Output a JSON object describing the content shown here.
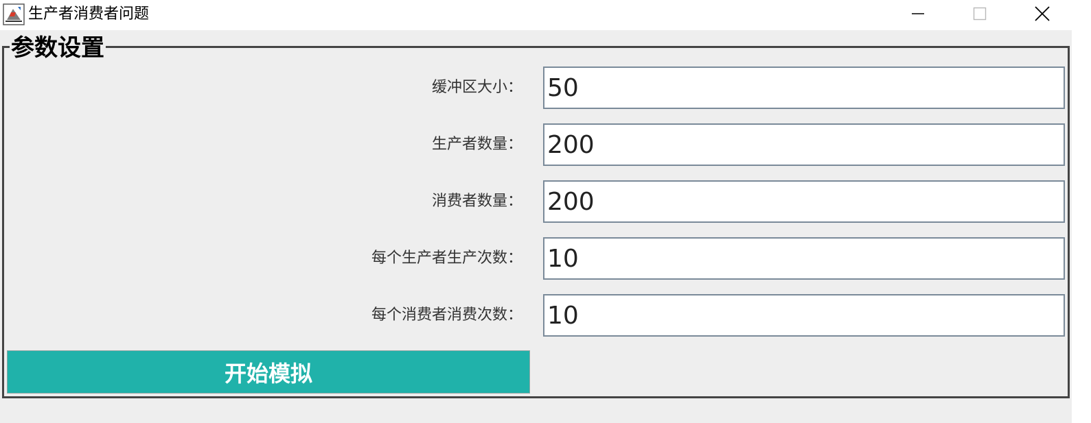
{
  "window": {
    "title": "生产者消费者问题",
    "icon": "java-app-icon",
    "controls": [
      "minimize-icon",
      "maximize-icon",
      "close-icon"
    ]
  },
  "group": {
    "title": "参数设置"
  },
  "fields": [
    {
      "label": "缓冲区大小：",
      "value": "50"
    },
    {
      "label": "生产者数量：",
      "value": "200"
    },
    {
      "label": "消费者数量：",
      "value": "200"
    },
    {
      "label": "每个生产者生产次数：",
      "value": "10"
    },
    {
      "label": "每个消费者消费次数：",
      "value": "10"
    }
  ],
  "actions": {
    "start_label": "开始模拟"
  },
  "colors": {
    "button_bg": "#20b2aa",
    "button_text": "#ffffff",
    "window_bg": "#eeeeee",
    "border": "#444444"
  }
}
